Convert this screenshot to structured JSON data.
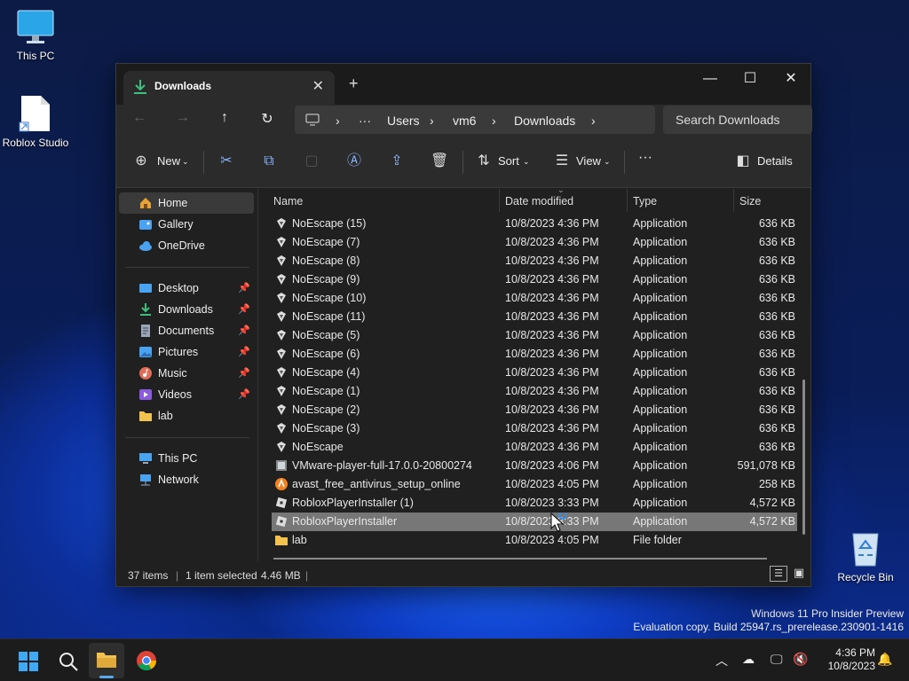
{
  "desktop": {
    "icons": [
      {
        "label": "This PC"
      },
      {
        "label": "Roblox Studio"
      },
      {
        "label": "Recycle Bin"
      }
    ],
    "watermark_line1": "Windows 11 Pro Insider Preview",
    "watermark_line2": "Evaluation copy. Build 25947.rs_prerelease.230901-1416"
  },
  "window": {
    "tab_title": "Downloads",
    "tab_close": "✕",
    "new_tab": "+",
    "controls": {
      "minimize": "—",
      "maximize": "☐",
      "close": "✕"
    }
  },
  "address": {
    "crumbs": [
      "Users",
      "vm6",
      "Downloads"
    ],
    "more": "···",
    "search_placeholder": "Search Downloads"
  },
  "toolbar": {
    "new_label": "New",
    "sort_label": "Sort",
    "view_label": "View",
    "details_label": "Details",
    "more": "···"
  },
  "sidebar": {
    "items": [
      {
        "label": "Home",
        "icon": "home-icon",
        "color": "#e8a23a"
      },
      {
        "label": "Gallery",
        "icon": "gallery-icon",
        "color": "#4aa3f0"
      },
      {
        "label": "OneDrive",
        "icon": "cloud-icon",
        "color": "#4aa3f0"
      },
      {
        "label": "Desktop",
        "icon": "desktop-icon",
        "color": "#4aa3f0"
      },
      {
        "label": "Downloads",
        "icon": "download-icon",
        "color": "#3fbf7f"
      },
      {
        "label": "Documents",
        "icon": "document-icon",
        "color": "#9aa7b8"
      },
      {
        "label": "Pictures",
        "icon": "pictures-icon",
        "color": "#4aa3f0"
      },
      {
        "label": "Music",
        "icon": "music-icon",
        "color": "#e06c5a"
      },
      {
        "label": "Videos",
        "icon": "videos-icon",
        "color": "#8c5ae0"
      },
      {
        "label": "lab",
        "icon": "folder-icon",
        "color": "#f2c14e"
      },
      {
        "label": "This PC",
        "icon": "computer-icon",
        "color": "#4aa3f0"
      },
      {
        "label": "Network",
        "icon": "network-icon",
        "color": "#4aa3f0"
      }
    ]
  },
  "columns": {
    "name": "Name",
    "date": "Date modified",
    "type": "Type",
    "size": "Size"
  },
  "files": [
    {
      "name": "NoEscape (15)",
      "date": "10/8/2023 4:36 PM",
      "type": "Application",
      "size": "636 KB"
    },
    {
      "name": "NoEscape (7)",
      "date": "10/8/2023 4:36 PM",
      "type": "Application",
      "size": "636 KB"
    },
    {
      "name": "NoEscape (8)",
      "date": "10/8/2023 4:36 PM",
      "type": "Application",
      "size": "636 KB"
    },
    {
      "name": "NoEscape (9)",
      "date": "10/8/2023 4:36 PM",
      "type": "Application",
      "size": "636 KB"
    },
    {
      "name": "NoEscape (10)",
      "date": "10/8/2023 4:36 PM",
      "type": "Application",
      "size": "636 KB"
    },
    {
      "name": "NoEscape (11)",
      "date": "10/8/2023 4:36 PM",
      "type": "Application",
      "size": "636 KB"
    },
    {
      "name": "NoEscape (5)",
      "date": "10/8/2023 4:36 PM",
      "type": "Application",
      "size": "636 KB"
    },
    {
      "name": "NoEscape (6)",
      "date": "10/8/2023 4:36 PM",
      "type": "Application",
      "size": "636 KB"
    },
    {
      "name": "NoEscape (4)",
      "date": "10/8/2023 4:36 PM",
      "type": "Application",
      "size": "636 KB"
    },
    {
      "name": "NoEscape (1)",
      "date": "10/8/2023 4:36 PM",
      "type": "Application",
      "size": "636 KB"
    },
    {
      "name": "NoEscape (2)",
      "date": "10/8/2023 4:36 PM",
      "type": "Application",
      "size": "636 KB"
    },
    {
      "name": "NoEscape (3)",
      "date": "10/8/2023 4:36 PM",
      "type": "Application",
      "size": "636 KB"
    },
    {
      "name": "NoEscape",
      "date": "10/8/2023 4:36 PM",
      "type": "Application",
      "size": "636 KB"
    },
    {
      "name": "VMware-player-full-17.0.0-20800274",
      "date": "10/8/2023 4:06 PM",
      "type": "Application",
      "size": "591,078 KB"
    },
    {
      "name": "avast_free_antivirus_setup_online",
      "date": "10/8/2023 4:05 PM",
      "type": "Application",
      "size": "258 KB"
    },
    {
      "name": "RobloxPlayerInstaller (1)",
      "date": "10/8/2023 3:33 PM",
      "type": "Application",
      "size": "4,572 KB"
    },
    {
      "name": "RobloxPlayerInstaller",
      "date": "10/8/2023 3:33 PM",
      "type": "Application",
      "size": "4,572 KB"
    },
    {
      "name": "lab",
      "date": "10/8/2023 4:05 PM",
      "type": "File folder",
      "size": ""
    }
  ],
  "status": {
    "items": "37 items",
    "selected": "1 item selected",
    "size": "4.46 MB"
  },
  "taskbar": {
    "time": "4:36 PM",
    "date": "10/8/2023"
  }
}
